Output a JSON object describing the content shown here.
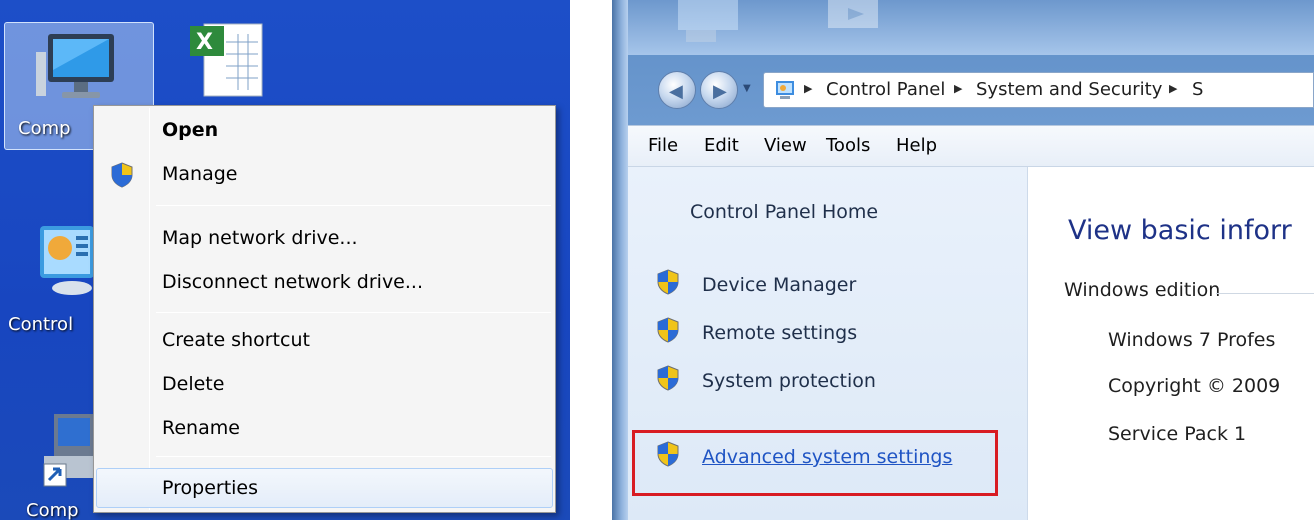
{
  "desktop": {
    "icons": [
      {
        "label": "Comp"
      },
      {
        "label": "Control"
      },
      {
        "label": "Comp"
      }
    ]
  },
  "context_menu": {
    "items": [
      {
        "label": "Open",
        "bold": true
      },
      {
        "label": "Manage",
        "shield": true
      },
      {
        "label": "Map network drive..."
      },
      {
        "label": "Disconnect network drive..."
      },
      {
        "label": "Create shortcut"
      },
      {
        "label": "Delete"
      },
      {
        "label": "Rename"
      },
      {
        "label": "Properties",
        "hovered": true
      }
    ]
  },
  "explorer": {
    "breadcrumb": [
      "Control Panel",
      "System and Security",
      "S"
    ],
    "menu": [
      "File",
      "Edit",
      "View",
      "Tools",
      "Help"
    ],
    "sidebar": {
      "home": "Control Panel Home",
      "links": [
        {
          "label": "Device Manager"
        },
        {
          "label": "Remote settings"
        },
        {
          "label": "System protection"
        },
        {
          "label": "Advanced system settings",
          "highlighted": true
        }
      ]
    },
    "content": {
      "heading": "View basic inforr",
      "section": "Windows edition",
      "lines": [
        "Windows 7 Profes",
        "Copyright © 2009",
        "Service Pack 1"
      ]
    }
  },
  "colors": {
    "desktop_blue": "#1846c0",
    "highlight_red": "#d81c23",
    "link_blue": "#1f54c4"
  }
}
